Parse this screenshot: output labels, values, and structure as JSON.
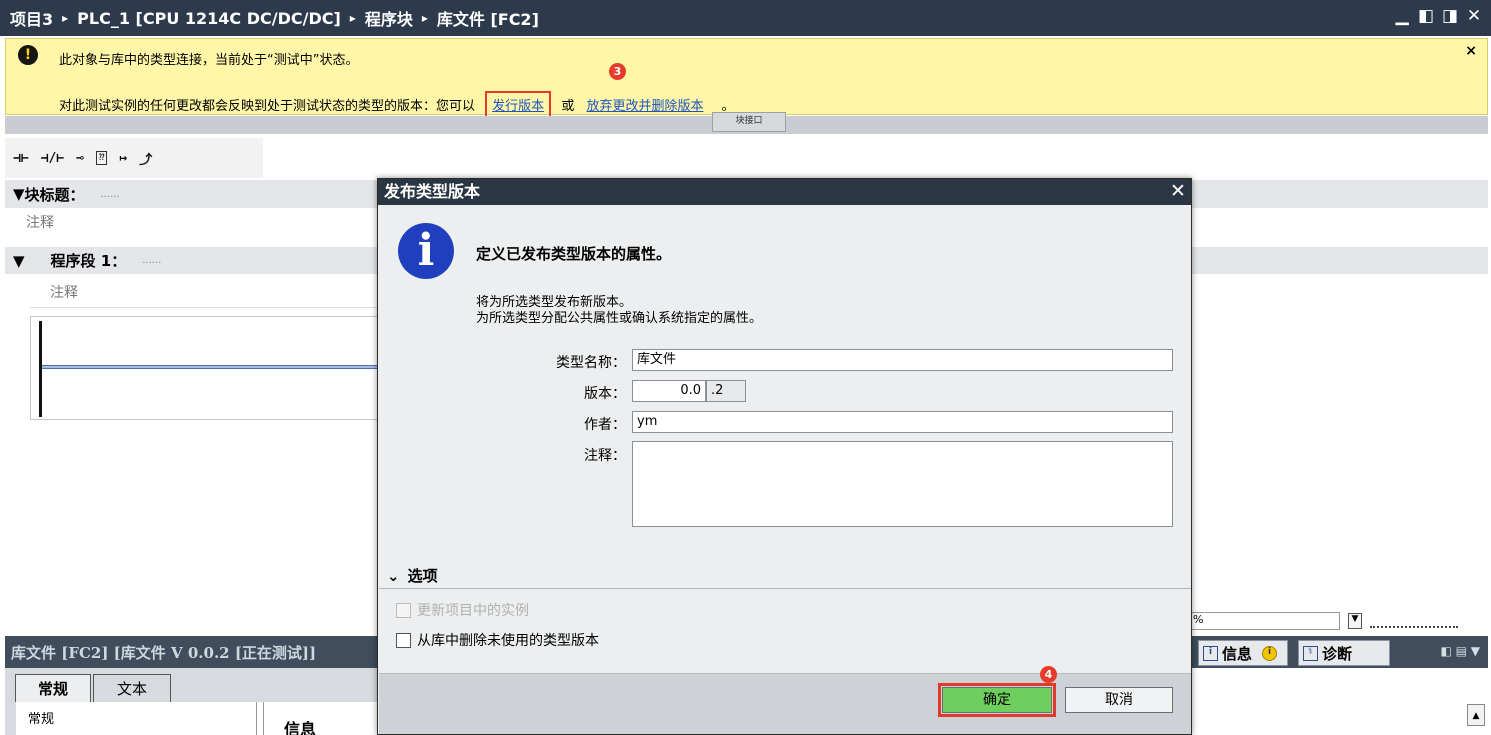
{
  "titlebar": {
    "crumbs": [
      "项目3",
      "PLC_1 [CPU 1214C DC/DC/DC]",
      "程序块",
      "库文件 [FC2]"
    ],
    "separator": "▸",
    "controls": [
      "▁",
      "◧",
      "◨",
      "✕"
    ]
  },
  "banner": {
    "icon": "!",
    "line1": "此对象与库中的类型连接，当前处于“测试中”状态。",
    "line2_prefix": "对此测试实例的任何更改都会反映到处于测试状态的类型的版本：您可以",
    "release_link": "发行版本",
    "or": "或",
    "discard_link": "放弃更改并删除版本",
    "suffix": "。",
    "close": "×",
    "step_badge": "3"
  },
  "editor": {
    "collapse_tab": "块接口",
    "tools": [
      "⊣⊢",
      "⊣/⊢",
      "⊸",
      "⁇",
      "↦",
      "⤴"
    ],
    "block_title_label": "块标题：",
    "block_title_dots": "......",
    "comment_placeholder": "注释",
    "segment_label": "程序段 1：",
    "segment_dots": "......",
    "segment_comment": "注释",
    "zoom_value": "%"
  },
  "properties": {
    "title": "库文件 [FC2] [库文件 V 0.0.2 [正在测试]]",
    "tabs": [
      "常规",
      "文本"
    ],
    "nav_item": "常规",
    "section_heading": "信息"
  },
  "inspector_tabs": {
    "info": "信息",
    "diagnostics": "诊断"
  },
  "dialog": {
    "title": "发布类型版本",
    "close": "✕",
    "heading": "定义已发布类型版本的属性。",
    "desc_line1": "将为所选类型发布新版本。",
    "desc_line2": "为所选类型分配公共属性或确认系统指定的属性。",
    "fields": {
      "type_name_label": "类型名称：",
      "type_name_value": "库文件",
      "version_label": "版本：",
      "version_major": "0.0",
      "version_minor": ".2",
      "author_label": "作者：",
      "author_value": "ym",
      "comment_label": "注释："
    },
    "options_label": "选项",
    "option1": "更新项目中的实例",
    "option2": "从库中删除未使用的类型版本",
    "ok_label": "确定",
    "cancel_label": "取消",
    "step_badge": "4"
  },
  "colors": {
    "titlebar_bg": "#2c3a4b",
    "banner_bg": "#fff6a8",
    "highlight_red": "#e03b2a",
    "ok_green": "#6fcf5e",
    "info_icon_blue": "#1f3fbf"
  }
}
